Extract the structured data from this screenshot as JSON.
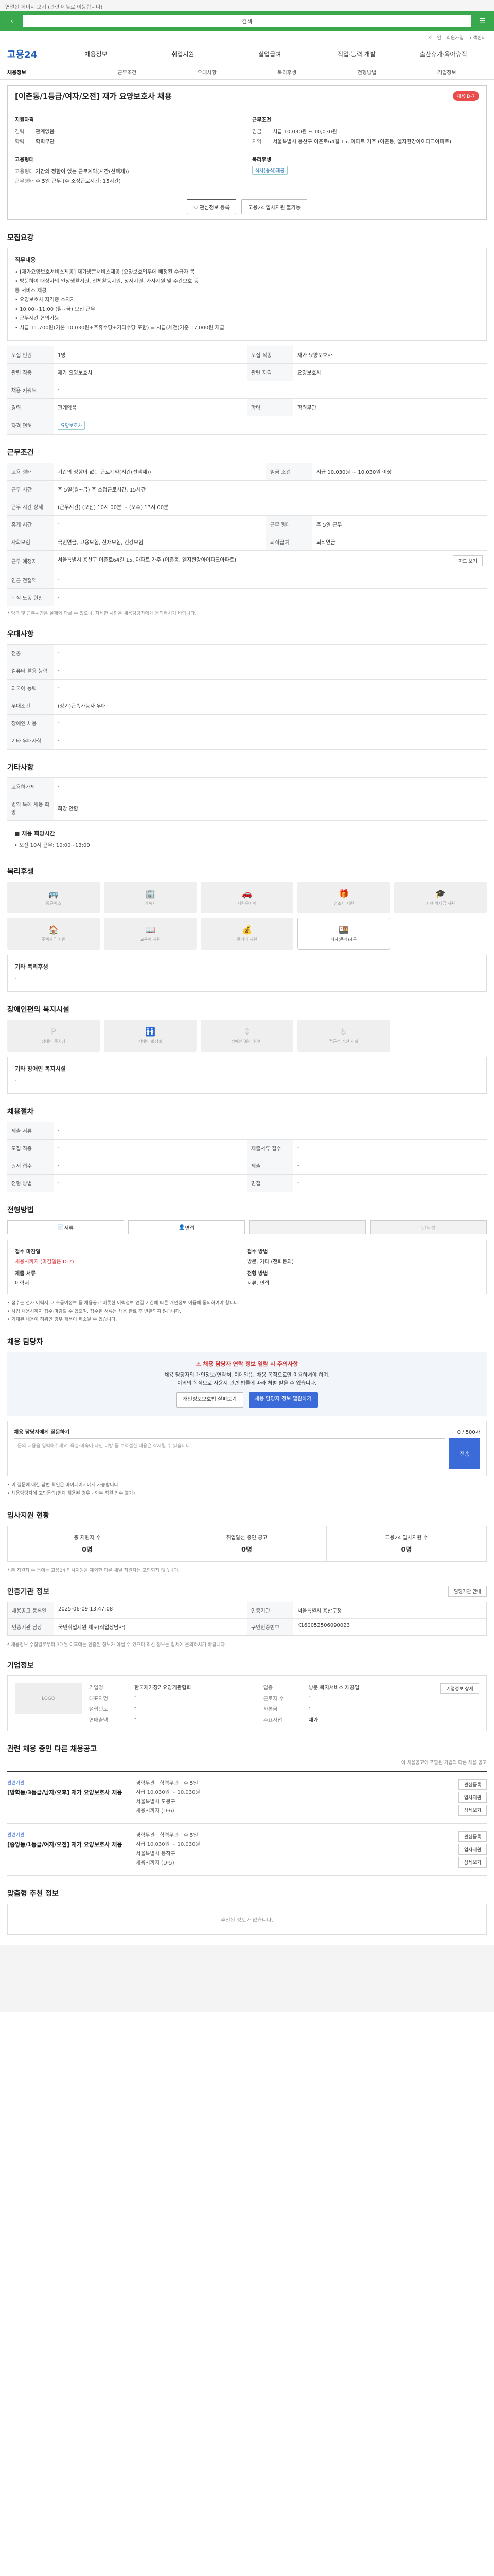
{
  "top_note": "연결된 페이지 보기 (관련 메뉴로 이동합니다)",
  "topbar": {
    "search_placeholder": "검색"
  },
  "util": [
    "로그인",
    "회원가입",
    "고객센터"
  ],
  "logo": "고용24",
  "gnb": [
    "채용정보",
    "취업지원",
    "실업급여",
    "직업·능력 개발",
    "출산휴가·육아휴직"
  ],
  "sub_nav": [
    "채용정보",
    "근무조건",
    "우대사항",
    "복리후생",
    "전형방법",
    "기업정보"
  ],
  "title": "[이촌동/1등급/여자/오전] 재가 요양보호사 채용",
  "title_badge": "채용 D-7",
  "head": {
    "company_group": "지원자격",
    "rows_left": [
      {
        "k": "경력",
        "v": "관계없음"
      },
      {
        "k": "학력",
        "v": "학력무관"
      }
    ],
    "work_group": "근무조건",
    "rows_right": [
      {
        "k": "임금",
        "v": "시급 10,030원 ~ 10,030원"
      },
      {
        "k": "지역",
        "v": "서울특별시 용산구 이촌로64길 15, 아파트 가주 (이촌동, 엘지한강아이파크아파트)"
      }
    ],
    "type_group": "고용형태",
    "rows_left2": [
      {
        "k": "고용형태",
        "v": "기간의 정함이 없는 근로계약(시간(선택제))"
      },
      {
        "k": "근무형태",
        "v": "주 5일 근무 (주 소정근로시간: 15시간)"
      }
    ],
    "welfare_group": "복리후생",
    "welfare_tag": "식사(중식)제공"
  },
  "head_buttons": [
    "관심정보 등록",
    "고용24 입사지원 불가능"
  ],
  "section_jobs": "모집요강",
  "duty_title": "직무내용",
  "duty_text": [
    "• [재가요양보호서비스제공] 재가방문서비스제공 (요양보호업무에 배정된 수급자 목",
    "• 방문하여 대상자의 일상생활지원, 신체활동지원, 정서지원, 가사지원 및 주간보호 등",
    "  등 서비스 제공",
    "• 요양보호사 자격증 소지자",
    "• 10:00~11:00 (월~금) 오전 근무",
    "• 근무시간 협의가능",
    "• 시급 11,700원(기본 10,030원+주휴수당+기타수당 포함) = 시급(세전)기준 17,000원 지급."
  ],
  "job_table": [
    {
      "k": "모집 인원",
      "v": "1명",
      "k2": "모집 직종",
      "v2": "재가 요양보호사"
    },
    {
      "k": "관련 직종",
      "v": "재가 요양보호사",
      "k2": "관련 자격",
      "v2": "요양보호사"
    },
    {
      "k": "채용 키워드",
      "v": "-",
      "k2": "",
      "v2": ""
    },
    {
      "k": "경력",
      "v": "관계없음",
      "k2": "학력",
      "v2": "학력무관"
    },
    {
      "k": "자격 면허",
      "v": "요양보호사",
      "k2": "",
      "v2": ""
    }
  ],
  "section_cond": "근무조건",
  "cond_table": [
    {
      "k": "고용 형태",
      "v": "기간의 정함이 없는 근로계약(시간(선택제))",
      "k2": "임금 조건",
      "v2": "시급 10,030원 ~ 10,030원 이상"
    },
    {
      "k": "근무 시간",
      "v": "주 5일(월~금) 주 소정근로시간: 15시간",
      "k2": "",
      "v2": ""
    },
    {
      "k": "근무 시간 상세",
      "v": "(근무시간) (오전) 10시 00분 ~ (오후) 13시 00분",
      "k2": "",
      "v2": ""
    },
    {
      "k": "휴게 시간",
      "v": "-",
      "k2": "근무 형태",
      "v2": "주 5일 근무"
    },
    {
      "k": "사회보험",
      "v": "국민연금, 고용보험, 산재보험, 건강보험",
      "k2": "퇴직급여",
      "v2": "퇴직연금"
    },
    {
      "k": "근무 예정지",
      "v": "서울특별시 용산구 이촌로64길 15, 아파트 가주 (이촌동, 엘지한강아이파크아파트)",
      "k2": "",
      "v2": ""
    },
    {
      "k": "인근 전철역",
      "v": "-",
      "k2": "",
      "v2": ""
    },
    {
      "k": "퇴직 노동 현황",
      "v": "-",
      "k2": "",
      "v2": ""
    }
  ],
  "cond_note": "* 임금 및 근무시간은 실제와 다를 수 있으니, 자세한 사항은 채용담당자에게 문의하시기 바랍니다.",
  "map_button": "지도 보기",
  "section_pref": "우대사항",
  "pref_table": [
    {
      "k": "전공",
      "v": "-"
    },
    {
      "k": "컴퓨터 활용 능력",
      "v": "-"
    },
    {
      "k": "외국어 능력",
      "v": "-"
    },
    {
      "k": "우대조건",
      "v": "(장기)근속가능자 우대"
    },
    {
      "k": "장애인 채용",
      "v": "-"
    },
    {
      "k": "기타 우대사항",
      "v": "-"
    }
  ],
  "section_extra": "기타사항",
  "extra_table": [
    {
      "k": "고용허가제",
      "v": "-"
    },
    {
      "k": "병역 특례 채용 희망",
      "v": "희망 안함"
    }
  ],
  "extra_time_title": "■ 채용 희망시간",
  "extra_time_text": "• 오전 10시 근무: 10:00~13:00",
  "section_welfare": "복리후생",
  "welfare": [
    {
      "label": "통근버스",
      "on": false
    },
    {
      "label": "기숙사",
      "on": false
    },
    {
      "label": "차량유지비",
      "on": false
    },
    {
      "label": "경조사 지원",
      "on": false
    },
    {
      "label": "자녀 학자금 지원",
      "on": false
    },
    {
      "label": "주택자금 지원",
      "on": false
    },
    {
      "label": "교육비 지원",
      "on": false
    },
    {
      "label": "중식비 지원",
      "on": false
    },
    {
      "label": "식사(중식)제공",
      "on": true
    }
  ],
  "welfare_etc_title": "기타 복리후생",
  "welfare_etc_text": "-",
  "section_barrier": "장애인편의 복지시설",
  "barriers": [
    "장애인 주차장",
    "장애인 화장실",
    "장애인 엘리베이터",
    "접근성 개선 시설"
  ],
  "barrier_etc_title": "기타 장애인 복지시설",
  "barrier_etc_text": "-",
  "section_hire": "채용절차",
  "hire_table": [
    {
      "k": "제출 서류",
      "v": "-",
      "k2": "",
      "v2": ""
    },
    {
      "k": "모집 직종",
      "v": "-",
      "k2": "제출서류 접수",
      "v2": "-"
    },
    {
      "k": "원서 접수",
      "v": "-",
      "k2": "제출",
      "v2": "-"
    },
    {
      "k": "전형 방법",
      "v": "-",
      "k2": "면접",
      "v2": "-"
    }
  ],
  "section_method": "전형방법",
  "pay_tabs": [
    "서류",
    "면접",
    "",
    "인적성"
  ],
  "method": {
    "l1": "접수 마감일",
    "l1v": "채용시까지 (마감일은 D-7)",
    "l2": "접수 방법",
    "l2v": "방문, 기타 (전화문의)",
    "l3": "전형 방법",
    "l3v": "서류, 면접",
    "l4": "제출 서류",
    "l4v": "이력서"
  },
  "method_notes": [
    "• 접수는 전자 이력서, 기초급여정보 등 채용공고 비롯한 이력정보 연결 기간에 따른 개인정보 이용에 동의하여야 합니다.",
    "• 사업 채용시까지 접수·마감할 수 있으며, 접수된 서류는 채용 완료 후 반환되지 않습니다.",
    "• 기재된 내용이 허위인 경우 채용이 취소될 수 있습니다."
  ],
  "section_contact": "채용 담당자",
  "contact": {
    "alert": "채용 담당자 연락 정보 열람 시 주의사항",
    "line1": "채용 담당자의 개인정보(연락처, 이메일)는 채용 목적으로만 이용하셔야 하며,",
    "line2": "이외의 목적으로 사용시 관련 법률에 따라 처벌 받을 수 있습니다.",
    "btn1": "개인정보보호법 살펴보기",
    "btn2": "채용 담당자 정보 열람하기"
  },
  "qna": {
    "title": "채용 담당자에게 질문하기",
    "count": "0 / 500자",
    "placeholder": "문의 내용을 입력해주세요. 욕설·비속어·타인 비방 등 부적절한 내용은 삭제될 수 있습니다.",
    "submit": "전송"
  },
  "qna_notes": [
    "• 이 질문에 대한 답변 확인은 마이페이지에서 가능합니다.",
    "• 채용담당자에 고민문의(현재 채용된 경우 - 외부 직원 접수 불가)"
  ],
  "section_status": "입사지원 현황",
  "stats": [
    {
      "label": "총 지원자 수",
      "val": "0명"
    },
    {
      "label": "취업알선 중인 공고",
      "val": "0명"
    },
    {
      "label": "고용24 입사지원 수",
      "val": "0명"
    }
  ],
  "stats_note": "* 총 지원자 수 등에는 고용24 입사지원을 제외한 다른 채널 지원자는 포함되지 않습니다.",
  "section_cert": "인증기관 정보",
  "cert_button": "담당기관 안내",
  "cert": [
    {
      "k": "채용공고 등록일",
      "v": "2025-06-09 13:47:08",
      "k2": "인증기관",
      "v2": "서울특별시 용산구청"
    },
    {
      "k": "인증기관 담당",
      "v": "국민취업지원 제도(직업상담사)",
      "k2": "구인인증번호",
      "v2": "K160052506090023"
    }
  ],
  "cert_note": "* 채용정보 수집일로부터 3개월 이후에는 인증된 정보가 아닐 수 있으며 최신 정보는 업체에 문의하시기 바랍니다.",
  "section_company": "기업정보",
  "company": {
    "logo": "LOGO",
    "rows": [
      {
        "k": "기업명",
        "v": "한국재가장기요양기관협회",
        "k2": "업종",
        "v2": "방문 복지서비스 제공업"
      },
      {
        "k": "대표자명",
        "v": "-",
        "k2": "근로자 수",
        "v2": "-"
      },
      {
        "k": "설립년도",
        "v": "-",
        "k2": "자본금",
        "v2": "-"
      },
      {
        "k": "연매출액",
        "v": "-",
        "k2": "주요사업",
        "v2": "재가"
      }
    ],
    "btn": "기업정보 상세"
  },
  "section_similar": "관련 채용 중인 다른 채용공고",
  "similar_hint": "이 채용공고에 포함된 기업의 다른 채용 공고",
  "jobs": [
    {
      "co": "관련기관",
      "title": "[방학동/3등급/남자/오후] 재가 요양보호사 채용",
      "t1": "경력무관",
      "t2": "학력무관",
      "t3": "주 5일",
      "pay": "시급 10,030원 ~ 10,030원",
      "area": "서울특별시 도봉구",
      "end": "채용시까지 (D-6)"
    },
    {
      "co": "관련기관",
      "title": "[중앙동/1등급/여자/오전] 재가 요양보호사 채용",
      "t1": "경력무관",
      "t2": "학력무관",
      "t3": "주 5일",
      "pay": "시급 10,030원 ~ 10,030원",
      "area": "서울특별시 동작구",
      "end": "채용시까지 (D-5)"
    }
  ],
  "job_buttons": [
    "관심등록",
    "입사지원",
    "상세보기"
  ],
  "section_ad": "맞춤형 추천 정보",
  "ad_empty": "추천된 정보가 없습니다."
}
